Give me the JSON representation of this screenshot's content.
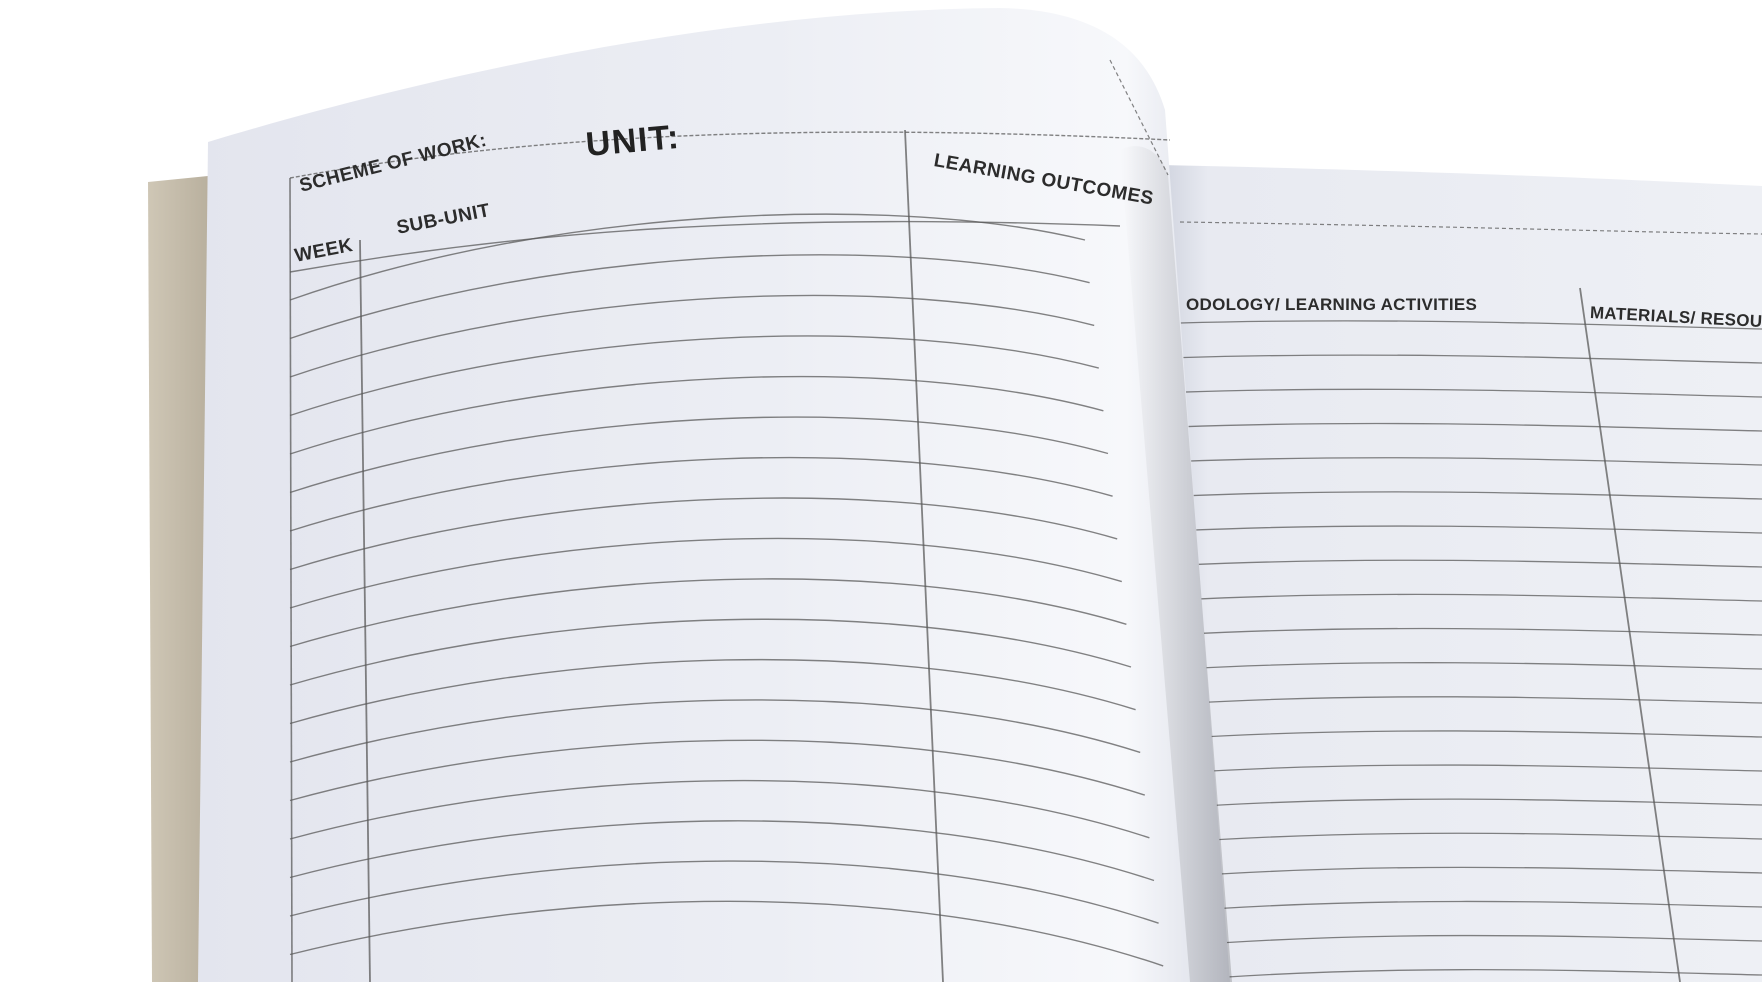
{
  "left_page": {
    "title": "SCHEME OF WORK:",
    "unit_label": "UNIT:",
    "column_week": "WEEK",
    "column_subunit": "SUB-UNIT",
    "column_outcomes": "LEARNING OUTCOMES"
  },
  "right_page": {
    "column_methodology": "ODOLOGY/ LEARNING ACTIVITIES",
    "column_materials": "MATERIALS/ RESOU"
  },
  "colors": {
    "paper": "#e7e9f0",
    "paper_bright": "#f6f7fa",
    "edge": "#c8bfae",
    "rule": "#5a5a5a"
  }
}
